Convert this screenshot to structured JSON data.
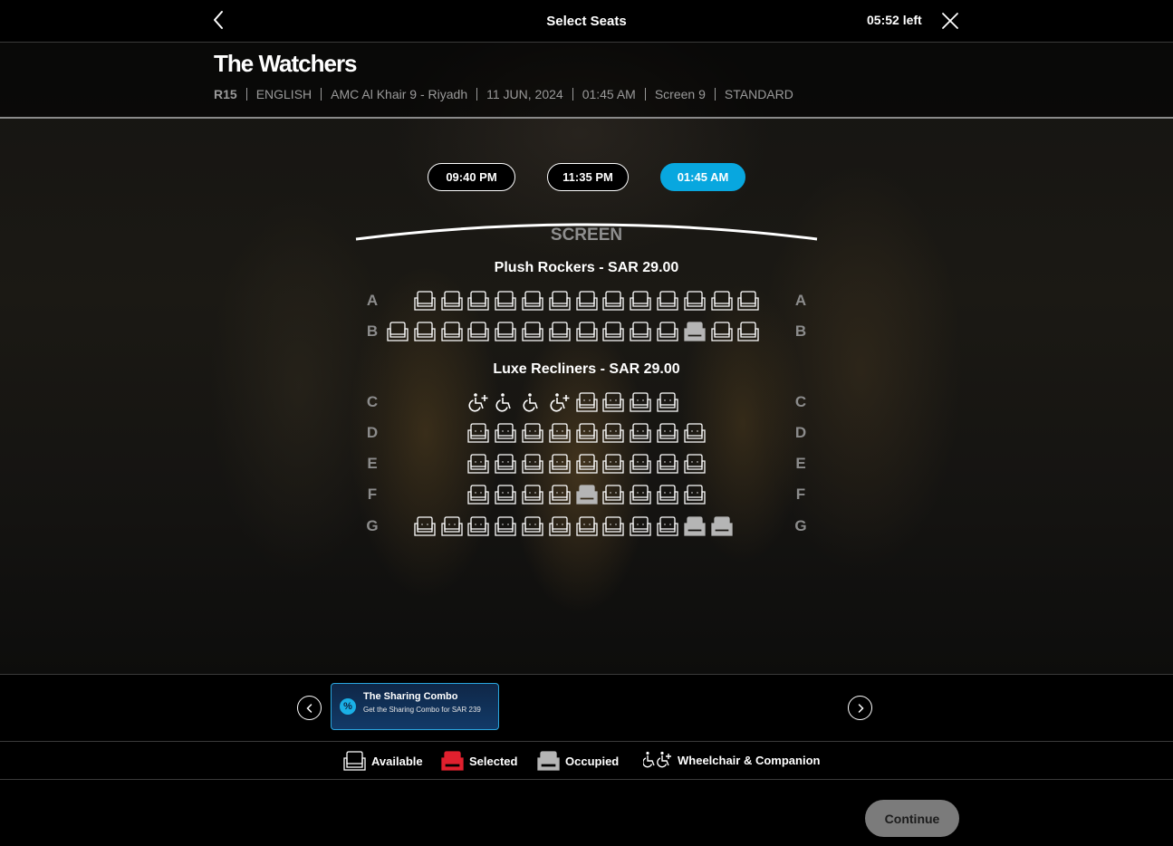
{
  "header": {
    "title": "Select Seats",
    "timer": "05:52 left"
  },
  "movie": {
    "title": "The Watchers",
    "meta": [
      "R15",
      "ENGLISH",
      "AMC Al Khair 9 - Riyadh",
      "11 JUN, 2024",
      "01:45 AM",
      "Screen 9",
      "STANDARD"
    ]
  },
  "showtimes": [
    {
      "label": "09:40 PM",
      "active": false
    },
    {
      "label": "11:35 PM",
      "active": false
    },
    {
      "label": "01:45 AM",
      "active": true
    }
  ],
  "screen_label": "SCREEN",
  "sections": [
    {
      "title": "Plush Rockers -  SAR  29.00",
      "seat_type": "rocker",
      "rows": [
        {
          "label": "A",
          "seats": [
            "a",
            "a",
            "a",
            "a",
            "a",
            "a",
            "a",
            "a",
            "a",
            "a",
            "a",
            "a",
            "a"
          ],
          "offset": 1
        },
        {
          "label": "B",
          "seats": [
            "a",
            "a",
            "a",
            "a",
            "a",
            "a",
            "a",
            "a",
            "a",
            "a",
            "a",
            "o",
            "a",
            "a"
          ],
          "offset": 0
        }
      ]
    },
    {
      "title": "Luxe Recliners -  SAR  29.00",
      "seat_type": "recliner",
      "rows": [
        {
          "label": "C",
          "seats": [
            "wc",
            "w",
            "w",
            "wc",
            "a",
            "a",
            "a",
            "a"
          ],
          "offset": 3
        },
        {
          "label": "D",
          "seats": [
            "a",
            "a",
            "a",
            "a",
            "a",
            "a",
            "a",
            "a",
            "a"
          ],
          "offset": 3
        },
        {
          "label": "E",
          "seats": [
            "a",
            "a",
            "a",
            "a",
            "a",
            "a",
            "a",
            "a",
            "a"
          ],
          "offset": 3
        },
        {
          "label": "F",
          "seats": [
            "a",
            "a",
            "a",
            "a",
            "o",
            "a",
            "a",
            "a",
            "a"
          ],
          "offset": 3
        },
        {
          "label": "G",
          "seats": [
            "a",
            "a",
            "a",
            "a",
            "a",
            "a",
            "a",
            "a",
            "a",
            "a",
            "o",
            "o"
          ],
          "offset": 1
        }
      ]
    }
  ],
  "offer": {
    "title": "The Sharing Combo",
    "description": "Get the Sharing Combo for SAR 239",
    "icon": "percent-icon"
  },
  "legend": {
    "available": "Available",
    "selected": "Selected",
    "occupied": "Occupied",
    "wheelchair": "Wheelchair & Companion"
  },
  "colors": {
    "accent": "#08a7df",
    "selected": "#e0202e",
    "occupied": "#b5b5b5",
    "available_outline": "#ffffff"
  },
  "footer": {
    "continue_label": "Continue"
  }
}
